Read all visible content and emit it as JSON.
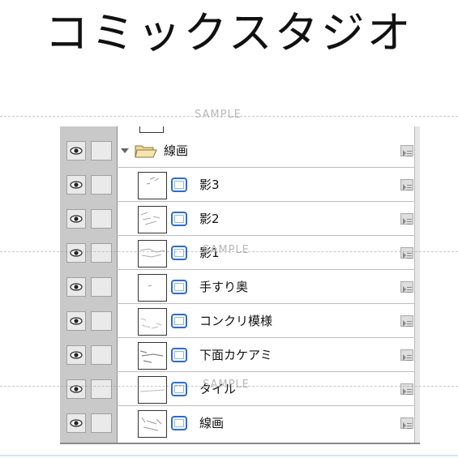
{
  "title": "コミックスタジオ",
  "watermark": "SAMPLE",
  "folder": {
    "name": "線画",
    "expanded": true
  },
  "layers": [
    {
      "name": "影3"
    },
    {
      "name": "影2"
    },
    {
      "name": "影1"
    },
    {
      "name": "手すり奥"
    },
    {
      "name": "コンクリ模様"
    },
    {
      "name": "下面カケアミ"
    },
    {
      "name": "タイル"
    },
    {
      "name": "線画"
    }
  ],
  "colors": {
    "visibility_column": "#c9c9c9",
    "raster_icon": "#2d6bd3",
    "row_separator": "#bdbdbd"
  },
  "icons": {
    "visibility": "eye-icon",
    "folder": "folder-open-icon",
    "layer_type": "raster-layer-icon",
    "properties": "layer-properties-icon"
  }
}
